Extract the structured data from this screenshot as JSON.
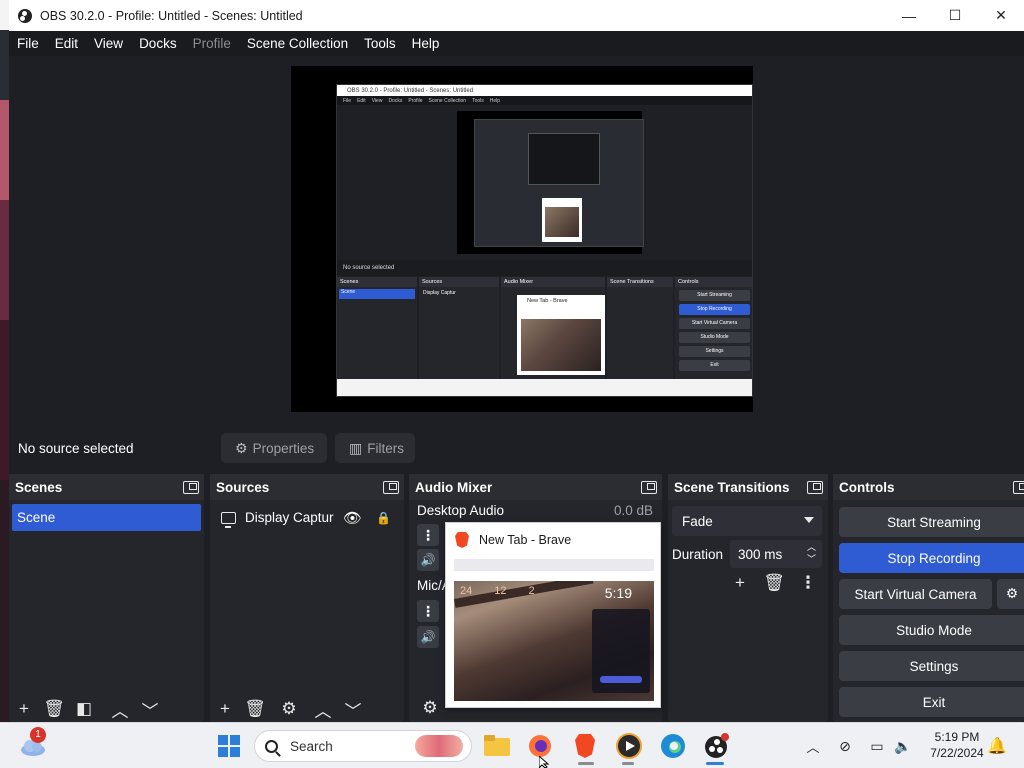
{
  "window": {
    "title": "OBS 30.2.0 - Profile: Untitled - Scenes: Untitled",
    "minimize": "—",
    "maximize": "☐",
    "close": "✕"
  },
  "menu": [
    {
      "label": "File",
      "disabled": false
    },
    {
      "label": "Edit",
      "disabled": false
    },
    {
      "label": "View",
      "disabled": false
    },
    {
      "label": "Docks",
      "disabled": false
    },
    {
      "label": "Profile",
      "disabled": true
    },
    {
      "label": "Scene Collection",
      "disabled": false
    },
    {
      "label": "Tools",
      "disabled": false
    },
    {
      "label": "Help",
      "disabled": false
    }
  ],
  "source_bar": {
    "status": "No source selected",
    "properties_label": "Properties",
    "filters_label": "Filters"
  },
  "scenes": {
    "title": "Scenes",
    "items": [
      "Scene"
    ]
  },
  "sources": {
    "title": "Sources",
    "items": [
      "Display Captur"
    ]
  },
  "audio_mixer": {
    "title": "Audio Mixer",
    "channels": [
      {
        "name": "Desktop Audio",
        "level": "0.0 dB"
      },
      {
        "name": "Mic/A",
        "level": ""
      }
    ]
  },
  "scene_transitions": {
    "title": "Scene Transitions",
    "transition": "Fade",
    "duration_label": "Duration",
    "duration_value": "300 ms"
  },
  "controls": {
    "title": "Controls",
    "buttons": [
      {
        "label": "Start Streaming",
        "active": false
      },
      {
        "label": "Stop Recording",
        "active": true
      },
      {
        "label": "Start Virtual Camera",
        "active": false
      },
      {
        "label": "Studio Mode",
        "active": false
      },
      {
        "label": "Settings",
        "active": false
      },
      {
        "label": "Exit",
        "active": false
      }
    ]
  },
  "popup": {
    "title": "New Tab - Brave",
    "thumbnail_clock": "5:19",
    "thumbnail_stats": [
      "24",
      "12",
      "2"
    ]
  },
  "preview": {
    "mini_title": "OBS 30.2.0 - Profile: Untitled - Scenes: Untitled",
    "mini_menu": [
      "File",
      "Edit",
      "View",
      "Docks",
      "Profile",
      "Scene Collection",
      "Tools",
      "Help"
    ],
    "mini_status": "No source selected",
    "mini_docks": [
      "Scenes",
      "Sources",
      "Audio Mixer",
      "Scene Transitions",
      "Controls"
    ],
    "mini_scene": "Scene",
    "mini_source": "Display Captur",
    "mini_buttons": [
      "Start Streaming",
      "Stop Recording",
      "Start Virtual Camera",
      "Studio Mode",
      "Settings",
      "Exit"
    ],
    "mini_popup_title": "New Tab - Brave"
  },
  "taskbar": {
    "search_placeholder": "Search",
    "weather_badge": "1",
    "time": "5:19 PM",
    "date": "7/22/2024"
  },
  "colors": {
    "accent": "#2f5bd3",
    "dock_bg": "#25262c",
    "window_bg": "#1e1f24"
  }
}
